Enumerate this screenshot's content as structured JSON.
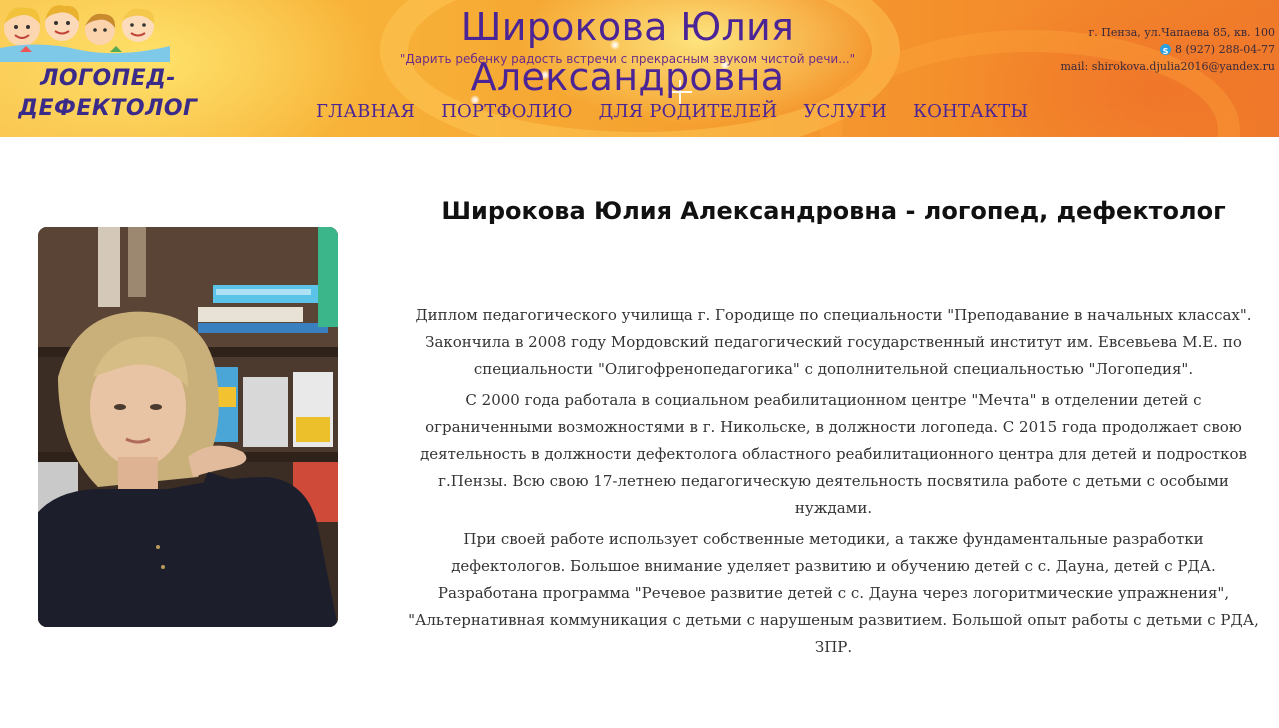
{
  "header": {
    "logo": {
      "line1": "ЛОГОПЕД-",
      "line2": "ДЕФЕКТОЛОГ"
    },
    "site_title": "Широкова Юлия Александровна",
    "slogan": "\"Дарить ребенку радость встречи с прекрасным звуком чистой речи...\"",
    "nav": [
      "ГЛАВНАЯ",
      "ПОРТФОЛИО",
      "ДЛЯ РОДИТЕЛЕЙ",
      "УСЛУГИ",
      "КОНТАКТЫ"
    ],
    "contacts": {
      "address": "г. Пенза, ул.Чапаева 85, кв. 100",
      "phone": "8 (927) 288-04-77",
      "email": "mail: shirokova.djulia2016@yandex.ru"
    }
  },
  "main": {
    "title": "Широкова Юлия Александровна - логопед, дефектолог",
    "paragraphs": [
      "Диплом педагогического училища г. Городище по специальности \"Преподавание в начальных классах\".",
      "Закончила в 2008 году Мордовский педагогический государственный институт им. Евсевьева М.Е. по специальности \"Олигофренопедагогика\" с дополнительной специальностью \"Логопедия\".",
      "С 2000 года работала в социальном реабилитационном центре \"Мечта\" в отделении детей с ограниченными возможностями в г. Никольске, в должности логопеда. С 2015 года продолжает свою деятельность в должности дефектолога областного реабилитационного центра для детей и подростков г.Пензы. Всю свою 17-летнею педагогическую деятельность посвятила работе с детьми с особыми нуждами.",
      "При своей работе использует собственные методики, а также фундаментальные разработки дефектологов. Большое внимание уделяет развитию и обучению детей с с. Дауна, детей с РДА. Разработана программа \"Речевое развитие детей с с. Дауна через логоритмические упражнения\", \"Альтернативная коммуникация с детьми с нарушеным развитием. Большой опыт работы с детьми с РДА, ЗПР."
    ]
  },
  "colors": {
    "brand_purple": "#4b2596",
    "header_orange": "#f5a330"
  }
}
